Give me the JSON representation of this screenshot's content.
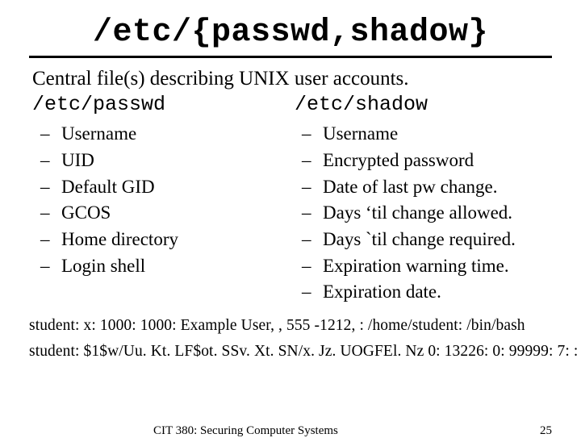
{
  "title": "/etc/{passwd,shadow}",
  "intro": "Central file(s) describing UNIX user accounts.",
  "left": {
    "heading": "/etc/passwd",
    "items": [
      "Username",
      "UID",
      "Default GID",
      "GCOS",
      "Home directory",
      "Login shell"
    ]
  },
  "right": {
    "heading": "/etc/shadow",
    "items": [
      "Username",
      "Encrypted password",
      "Date of last pw change.",
      "Days ‘til change allowed.",
      "Days `til change required.",
      "Expiration warning time.",
      "Expiration date."
    ]
  },
  "examples": {
    "line1": "student: x: 1000: 1000: Example User, , 555 -1212, : /home/student: /bin/bash",
    "line2": "student: $1$w/Uu. Kt. LF$ot. SSv. Xt. SN/x. Jz. UOGFEl. Nz 0: 13226: 0: 99999: 7: : :"
  },
  "footer": {
    "course": "CIT 380: Securing Computer Systems",
    "page": "25"
  }
}
